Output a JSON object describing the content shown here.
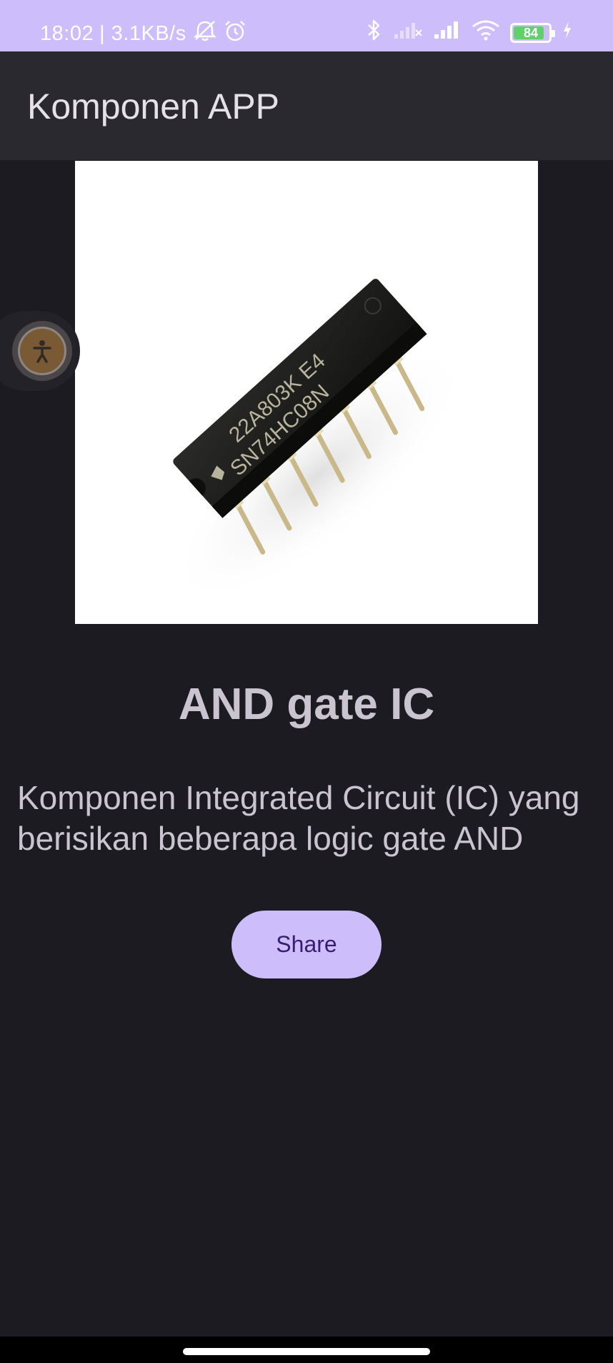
{
  "status_bar": {
    "time": "18:02",
    "speed": "| 3.1KB/s",
    "battery": "84",
    "bg_color": "#cdbdfb"
  },
  "app_bar": {
    "title": "Komponen APP"
  },
  "component": {
    "name": "AND gate IC",
    "description": "Komponen Integrated Circuit (IC) yang berisikan beberapa logic gate AND",
    "chip_label_line1": "22A803K E4",
    "chip_label_line2": "SN74HC08N"
  },
  "actions": {
    "share_label": "Share"
  },
  "colors": {
    "accent": "#cdbdfb",
    "background": "#1c1b21",
    "app_bar": "#2b2930",
    "button_text": "#381e72"
  }
}
